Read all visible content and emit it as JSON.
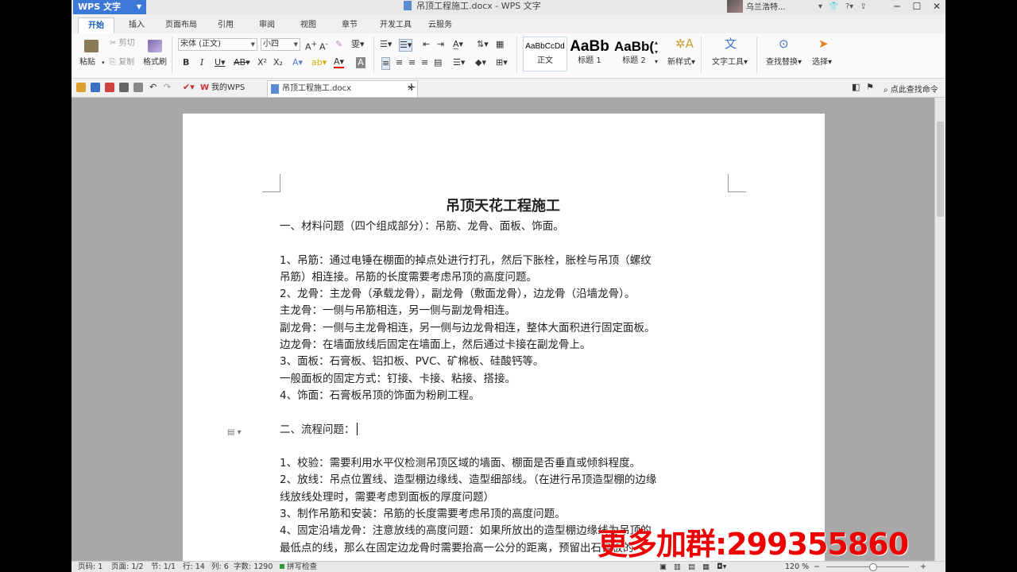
{
  "titlebar": {
    "app_button": "WPS 文字",
    "doc_title": "吊顶工程施工.docx - WPS 文字",
    "user": "乌兰浩特..."
  },
  "tabs": [
    "开始",
    "插入",
    "页面布局",
    "引用",
    "审阅",
    "视图",
    "章节",
    "开发工具",
    "云服务"
  ],
  "ribbon": {
    "paste": "粘贴",
    "cut": "剪切",
    "copy": "复制",
    "format_painter": "格式刷",
    "font_name": "宋体 (正文)",
    "font_size": "小四",
    "styles": [
      {
        "preview": "AaBbCcDd",
        "label": "正文"
      },
      {
        "preview": "AaBb",
        "label": "标题 1"
      },
      {
        "preview": "AaBb(",
        "label": "标题 2"
      }
    ],
    "new_style": "新样式",
    "text_tools": "文字工具",
    "find_replace": "查找替换",
    "select": "选择"
  },
  "doc_tabs": [
    {
      "label": "我的WPS",
      "active": false
    },
    {
      "label": "吊顶工程施工.docx",
      "active": true
    }
  ],
  "search_placeholder": "点此查找命令",
  "document": {
    "title": "吊顶天花工程施工",
    "paragraphs": [
      "一、材料问题（四个组成部分）：吊筋、龙骨、面板、饰面。",
      "",
      "1、吊筋：通过电锤在棚面的掉点处进行打孔，然后下胀栓，胀栓与吊顶（螺纹",
      "吊筋）相连接。吊筋的长度需要考虑吊顶的高度问题。",
      "2、龙骨：主龙骨（承载龙骨），副龙骨（敷面龙骨），边龙骨（沿墙龙骨）。",
      "主龙骨：一侧与吊筋相连，另一侧与副龙骨相连。",
      "副龙骨：一侧与主龙骨相连，另一侧与边龙骨相连，整体大面积进行固定面板。",
      "边龙骨：在墙面放线后固定在墙面上，然后通过卡接在副龙骨上。",
      "3、面板：石膏板、铝扣板、PVC、矿棉板、硅酸钙等。",
      "一般面板的固定方式：钉接、卡接、粘接、搭接。",
      "4、饰面：石膏板吊顶的饰面为粉刷工程。",
      "",
      "二、流程问题：",
      "",
      "1、校验：需要利用水平仪检测吊顶区域的墙面、棚面是否垂直或倾斜程度。",
      "2、放线：吊点位置线、造型棚边缘线、造型细部线。（在进行吊顶造型棚的边缘",
      "线放线处理时，需要考虑到面板的厚度问题）",
      "3、制作吊筋和安装：吊筋的长度需要考虑吊顶的高度问题。",
      "4、固定沿墙龙骨：注意放线的高度问题：如果所放出的造型棚边缘线为吊顶的",
      "最低点的线，那么在固定边龙骨时需要抬高一公分的距离，预留出石膏板的"
    ]
  },
  "status": {
    "page_num": "页码: 1",
    "pages": "页面: 1/2",
    "section": "节: 1/1",
    "row": "行: 14",
    "col": "列: 6",
    "words": "字数: 1290",
    "spell": "拼写检查",
    "zoom": "120 %"
  },
  "overlay_text": "更多加群:299355860"
}
